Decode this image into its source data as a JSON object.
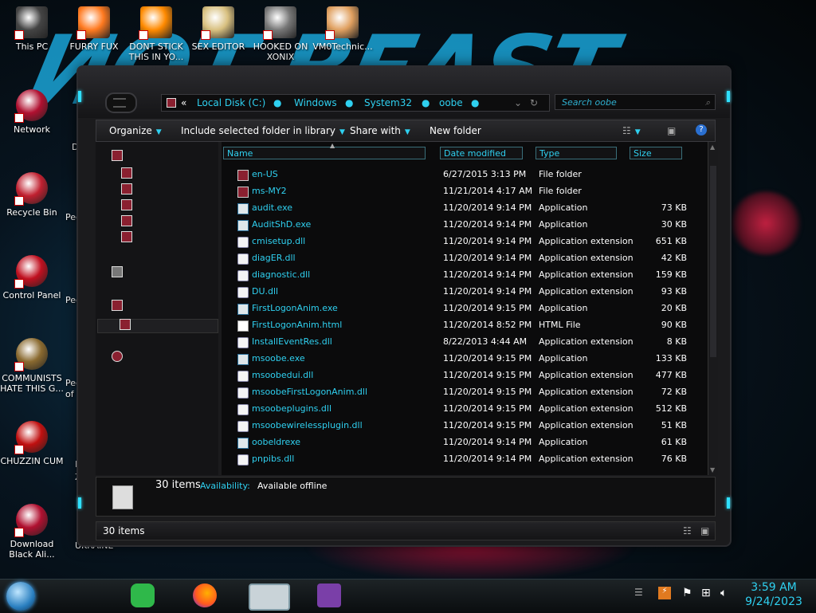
{
  "desktop": {
    "icons": [
      {
        "label": "This PC"
      },
      {
        "label": "FURRY FUX"
      },
      {
        "label": "DONT STICK THIS IN YO..."
      },
      {
        "label": "SEX EDITOR"
      },
      {
        "label": "HOOKED ON XONIX"
      },
      {
        "label": "VM0Technic..."
      },
      {
        "label": "Network"
      },
      {
        "label": "Recycle Bin"
      },
      {
        "label": "Control Panel"
      },
      {
        "label": "COMMUNISTS HATE THIS G..."
      },
      {
        "label": "CHUZZIN CUM"
      },
      {
        "label": "Download Black Ali..."
      }
    ],
    "partial_labels": [
      "DU",
      "Peg",
      "Peg",
      "Peg",
      "of V",
      "P",
      "Z",
      "UKRAINE"
    ]
  },
  "explorer": {
    "breadcrumb": [
      "Local Disk (C:)",
      "Windows",
      "System32",
      "oobe"
    ],
    "breadcrumb_prefix": "«",
    "search_placeholder": "Search oobe",
    "toolbar": {
      "organize": "Organize",
      "include": "Include selected folder in library",
      "share": "Share with",
      "new_folder": "New folder"
    },
    "columns": {
      "name": "Name",
      "date": "Date modified",
      "type": "Type",
      "size": "Size"
    },
    "files": [
      {
        "name": "en-US",
        "date": "6/27/2015 3:13 PM",
        "type": "File folder",
        "size": "",
        "icon": "folder-icon"
      },
      {
        "name": "ms-MY2",
        "date": "11/21/2014 4:17 AM",
        "type": "File folder",
        "size": "",
        "icon": "folder-icon"
      },
      {
        "name": "audit.exe",
        "date": "11/20/2014 9:14 PM",
        "type": "Application",
        "size": "73 KB",
        "icon": "exe-icon"
      },
      {
        "name": "AuditShD.exe",
        "date": "11/20/2014 9:14 PM",
        "type": "Application",
        "size": "30 KB",
        "icon": "exe-icon"
      },
      {
        "name": "cmisetup.dll",
        "date": "11/20/2014 9:14 PM",
        "type": "Application extension",
        "size": "651 KB",
        "icon": "dll-icon"
      },
      {
        "name": "diagER.dll",
        "date": "11/20/2014 9:14 PM",
        "type": "Application extension",
        "size": "42 KB",
        "icon": "dll-icon"
      },
      {
        "name": "diagnostic.dll",
        "date": "11/20/2014 9:14 PM",
        "type": "Application extension",
        "size": "159 KB",
        "icon": "dll-icon"
      },
      {
        "name": "DU.dll",
        "date": "11/20/2014 9:14 PM",
        "type": "Application extension",
        "size": "93 KB",
        "icon": "dll-icon"
      },
      {
        "name": "FirstLogonAnim.exe",
        "date": "11/20/2014 9:15 PM",
        "type": "Application",
        "size": "20 KB",
        "icon": "exe-icon"
      },
      {
        "name": "FirstLogonAnim.html",
        "date": "11/20/2014 8:52 PM",
        "type": "HTML File",
        "size": "90 KB",
        "icon": "html-icon"
      },
      {
        "name": "InstallEventRes.dll",
        "date": "8/22/2013 4:44 AM",
        "type": "Application extension",
        "size": "8 KB",
        "icon": "dll-icon"
      },
      {
        "name": "msoobe.exe",
        "date": "11/20/2014 9:15 PM",
        "type": "Application",
        "size": "133 KB",
        "icon": "exe-icon"
      },
      {
        "name": "msoobedui.dll",
        "date": "11/20/2014 9:15 PM",
        "type": "Application extension",
        "size": "477 KB",
        "icon": "dll-icon"
      },
      {
        "name": "msoobeFirstLogonAnim.dll",
        "date": "11/20/2014 9:15 PM",
        "type": "Application extension",
        "size": "72 KB",
        "icon": "dll-icon"
      },
      {
        "name": "msoobeplugins.dll",
        "date": "11/20/2014 9:15 PM",
        "type": "Application extension",
        "size": "512 KB",
        "icon": "dll-icon"
      },
      {
        "name": "msoobewirelessplugin.dll",
        "date": "11/20/2014 9:15 PM",
        "type": "Application extension",
        "size": "51 KB",
        "icon": "dll-icon"
      },
      {
        "name": "oobeldrexe",
        "date": "11/20/2014 9:14 PM",
        "type": "Application",
        "size": "61 KB",
        "icon": "exe-icon"
      },
      {
        "name": "pnpibs.dll",
        "date": "11/20/2014 9:14 PM",
        "type": "Application extension",
        "size": "76 KB",
        "icon": "dll-icon"
      }
    ],
    "details": {
      "count": "30 items",
      "availability_label": "Availability:",
      "availability_value": "Available offline"
    },
    "status": {
      "count": "30 items"
    }
  },
  "taskbar": {
    "time": "3:59 AM",
    "date": "9/24/2023"
  },
  "colors": {
    "accent": "#2fd0f0",
    "window_bg": "#1b1b1d",
    "content_bg": "#0b0b0c"
  }
}
